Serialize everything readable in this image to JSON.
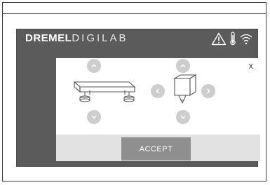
{
  "brand": {
    "part1": "DREMEL",
    "part2": "DIGILAB"
  },
  "status_icons": [
    "warning-icon",
    "thermometer-icon",
    "wifi-icon"
  ],
  "dialog": {
    "close_label": "x",
    "accept_label": "ACCEPT",
    "bed_controls": [
      "chevron-up-icon",
      "chevron-down-icon"
    ],
    "extruder_controls": [
      "chevron-up-icon",
      "chevron-down-icon",
      "chevron-left-icon",
      "chevron-right-icon"
    ]
  },
  "colors": {
    "screen_bg": "#5b5b5b",
    "card_bg": "#ffffff",
    "footer_bg": "#e2e2e2",
    "button_bg": "#8f8f8f",
    "control_bg": "#cdcdcd"
  }
}
